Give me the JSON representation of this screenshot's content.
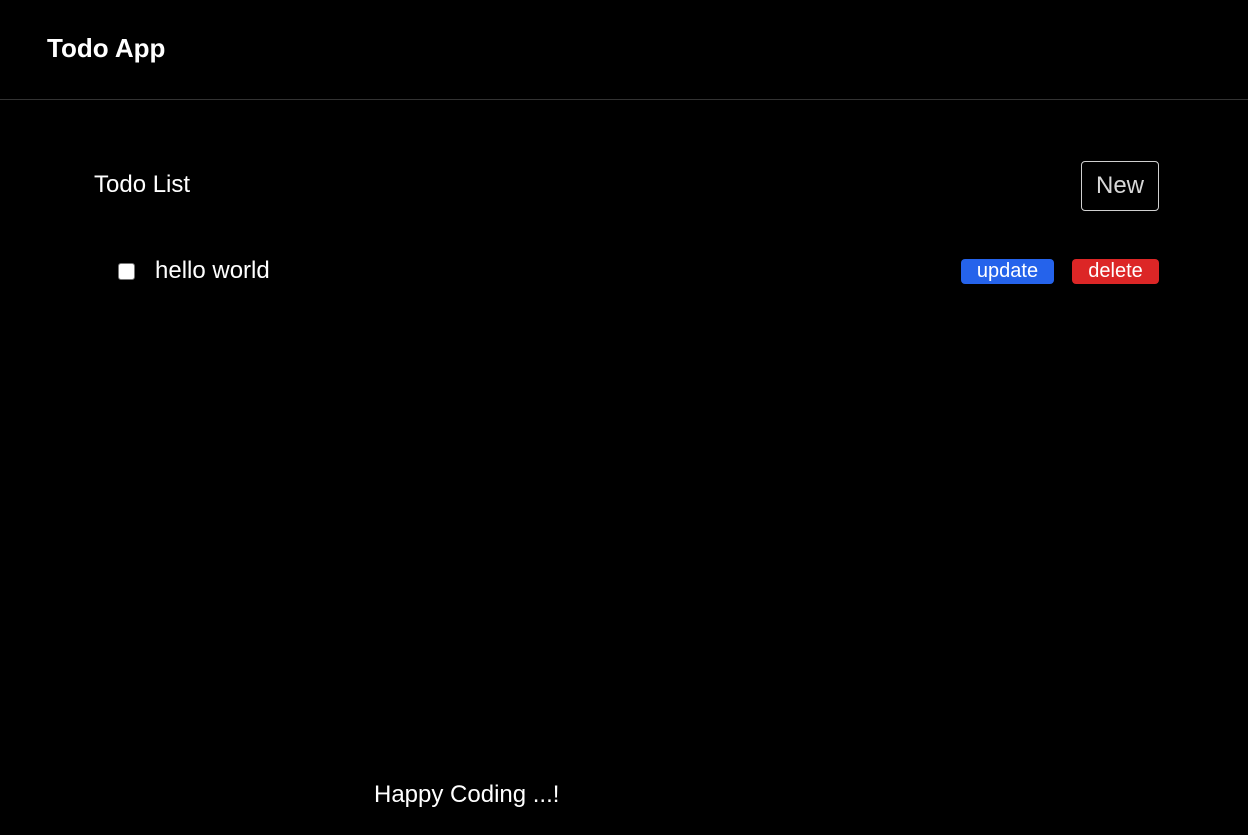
{
  "header": {
    "title": "Todo App"
  },
  "main": {
    "list_title": "Todo List",
    "new_button_label": "New",
    "todos": [
      {
        "text": "hello world",
        "checked": false,
        "update_label": "update",
        "delete_label": "delete"
      }
    ]
  },
  "footer": {
    "text": "Happy Coding ...!"
  },
  "colors": {
    "background": "#000000",
    "text": "#ffffff",
    "update_button": "#2563eb",
    "delete_button": "#dc2626"
  }
}
